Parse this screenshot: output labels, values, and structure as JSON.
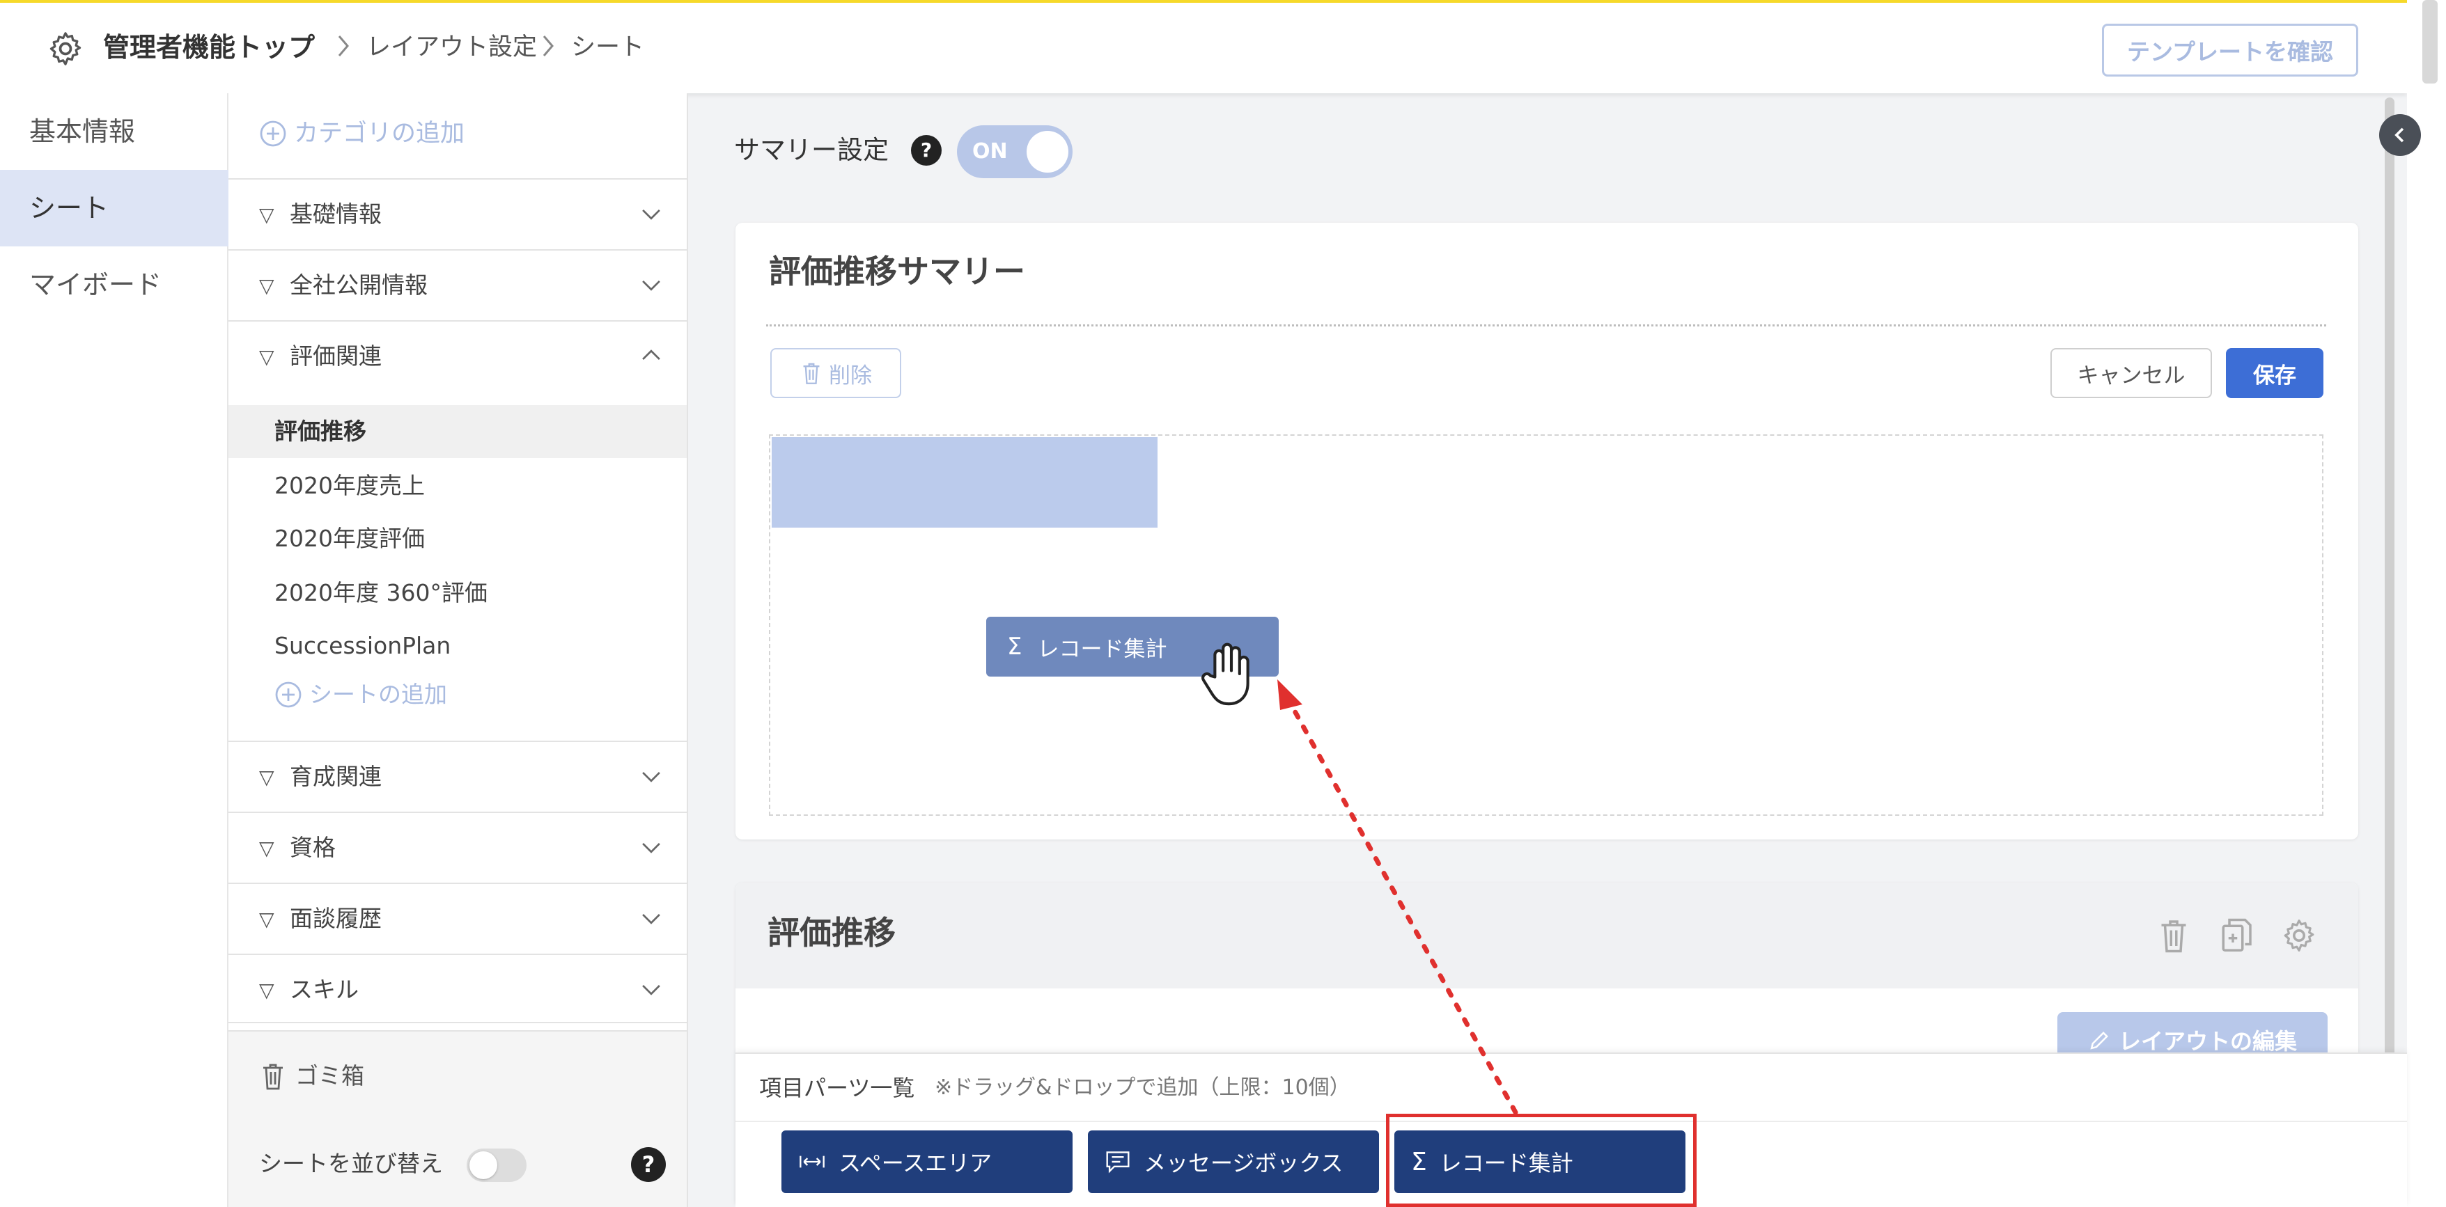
{
  "header": {
    "root": "管理者機能トップ",
    "crumbs": [
      "レイアウト設定",
      "シート"
    ],
    "template_button": "テンプレートを確認"
  },
  "left_nav": [
    "基本情報",
    "シート",
    "マイボード"
  ],
  "category_panel": {
    "add_category": "カテゴリの追加",
    "categories": [
      "基礎情報",
      "全社公開情報",
      "評価関連",
      "育成関連",
      "資格",
      "面談履歴",
      "スキル"
    ],
    "sheets": [
      "評価推移",
      "2020年度売上",
      "2020年度評価",
      "2020年度 360°評価",
      "SuccessionPlan"
    ],
    "add_sheet": "シートの追加",
    "trash": "ゴミ箱",
    "sort_label": "シートを並び替え",
    "sort_on": false,
    "help": "?"
  },
  "summary": {
    "label": "サマリー設定",
    "toggle_label": "ON",
    "toggle_on": true
  },
  "summary_card": {
    "title": "評価推移サマリー",
    "delete": "削除",
    "cancel": "キャンセル",
    "save": "保存",
    "drag_item": "レコード集計"
  },
  "sheet_card": {
    "title": "評価推移",
    "layout_edit": "レイアウトの編集"
  },
  "parts_panel": {
    "title": "項目パーツ一覧",
    "note": "※ドラッグ&ドロップで追加（上限：10個）",
    "parts": [
      "スペースエリア",
      "メッセージボックス",
      "レコード集計"
    ]
  },
  "colors": {
    "accent_yellow": "#f6d92a",
    "primary_blue": "#3d6ed6",
    "navy_button": "#203e7c",
    "highlight_red": "#e0302e",
    "drop_highlight": "#bbcbec"
  },
  "icons": [
    "gear-icon",
    "chevron-right-icon",
    "chevron-down-icon",
    "chevron-up-icon",
    "plus-circle-icon",
    "trash-icon",
    "copy-icon",
    "pencil-icon",
    "sigma-icon",
    "hand-cursor-icon",
    "message-icon",
    "space-icon",
    "collapse-left-icon"
  ]
}
